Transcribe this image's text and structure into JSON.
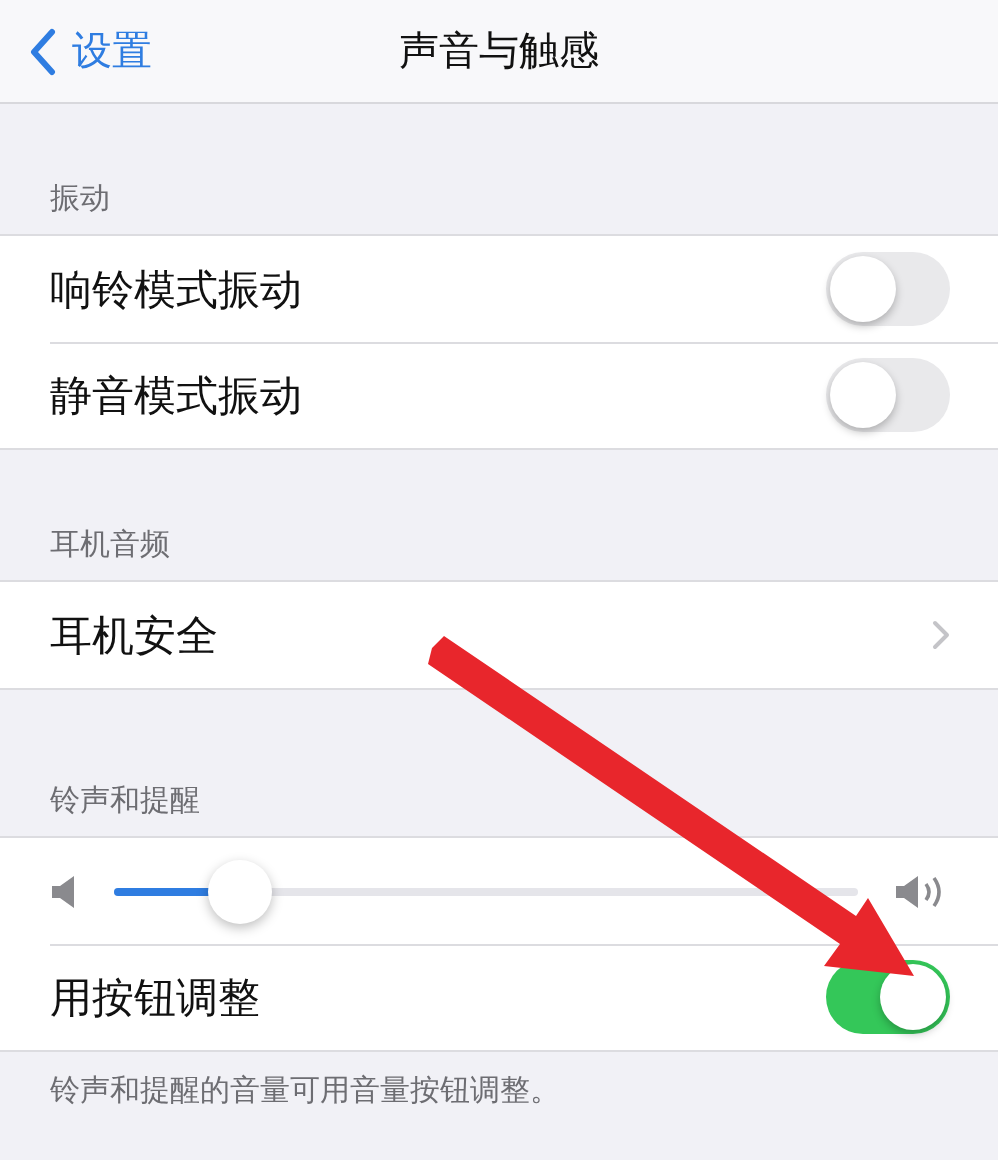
{
  "nav": {
    "back_label": "设置",
    "title": "声音与触感"
  },
  "sections": [
    {
      "header": "振动",
      "rows": [
        {
          "kind": "toggle",
          "label": "响铃模式振动",
          "on": false
        },
        {
          "kind": "toggle",
          "label": "静音模式振动",
          "on": false
        }
      ]
    },
    {
      "header": "耳机音频",
      "rows": [
        {
          "kind": "link",
          "label": "耳机安全"
        }
      ]
    },
    {
      "header": "铃声和提醒",
      "rows": [
        {
          "kind": "slider",
          "level": 0.17
        },
        {
          "kind": "toggle",
          "label": "用按钮调整",
          "on": true
        }
      ],
      "footer": "铃声和提醒的音量可用音量按钮调整。"
    }
  ],
  "annotations": [
    {
      "kind": "arrow"
    }
  ]
}
